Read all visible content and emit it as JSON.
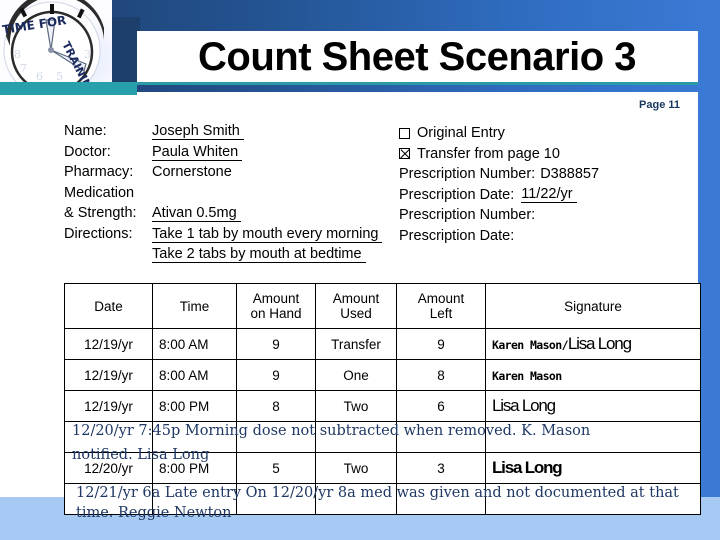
{
  "header": {
    "title": "Count Sheet Scenario 3",
    "page_label": "Page 11",
    "logo_line1": "TIME FOR",
    "logo_line2": "TRAINING",
    "accent_teal": "#2a9aa6",
    "accent_blue": "#3a79d4",
    "navy": "#1e3e6b"
  },
  "form": {
    "left": [
      {
        "label": "Name:",
        "value": "Joseph Smith",
        "underline": true
      },
      {
        "label": "Doctor:",
        "value": "Paula Whiten",
        "underline": true
      },
      {
        "label": "Pharmacy:",
        "value": "Cornerstone",
        "underline": false
      },
      {
        "label": "Medication",
        "value": "",
        "underline": false
      },
      {
        "label": "& Strength:",
        "value": "Ativan 0.5mg",
        "underline": true
      },
      {
        "label": "Directions:",
        "value": "Take 1 tab by mouth every morning",
        "underline": true
      },
      {
        "label": "",
        "value": "Take 2 tabs by mouth at bedtime",
        "underline": true
      }
    ],
    "right": {
      "original_entry_label": "Original Entry",
      "original_entry_checked": false,
      "transfer_label": "Transfer  from page 10",
      "transfer_checked": true,
      "rx_number_label": "Prescription Number:",
      "rx_number_value": "D388857",
      "rx_date_label": "Prescription Date:",
      "rx_date_value": "11/22/yr",
      "rx_number_label_2": "Prescription Number:",
      "rx_number_value_2": "",
      "rx_date_label_2": "Prescription Date:",
      "rx_date_value_2": ""
    }
  },
  "table": {
    "headers": [
      {
        "line1": "Date",
        "line2": ""
      },
      {
        "line1": "Time",
        "line2": ""
      },
      {
        "line1": "Amount",
        "line2": "on Hand"
      },
      {
        "line1": "Amount",
        "line2": "Used"
      },
      {
        "line1": "Amount",
        "line2": "Left"
      },
      {
        "line1": "Signature",
        "line2": ""
      }
    ],
    "rows": [
      {
        "date": "12/19/yr",
        "time": "8:00 AM",
        "on_hand": "9",
        "used": "Transfer",
        "left": "9",
        "sig_a": "Karen Mason",
        "sig_sep": "/",
        "sig_b": "Lisa Long",
        "sig_b_bold": false
      },
      {
        "date": "12/19/yr",
        "time": "8:00 AM",
        "on_hand": "9",
        "used": "One",
        "left": "8",
        "sig_a": "Karen Mason",
        "sig_sep": "",
        "sig_b": "",
        "sig_b_bold": false
      },
      {
        "date": "12/19/yr",
        "time": "8:00 PM",
        "on_hand": "8",
        "used": "Two",
        "left": "6",
        "sig_a": "",
        "sig_sep": "",
        "sig_b": "Lisa Long",
        "sig_b_bold": false
      },
      {
        "date": "",
        "time": "",
        "on_hand": "",
        "used": "",
        "left": "",
        "sig_a": "",
        "sig_sep": "",
        "sig_b": "",
        "sig_b_bold": false
      },
      {
        "date": "12/20/yr",
        "time": "8:00 PM",
        "on_hand": "5",
        "used": "Two",
        "left": "3",
        "sig_a": "",
        "sig_sep": "",
        "sig_b": "Lisa Long",
        "sig_b_bold": true
      },
      {
        "date": "",
        "time": "",
        "on_hand": "",
        "used": "",
        "left": "",
        "sig_a": "",
        "sig_sep": "",
        "sig_b": "",
        "sig_b_bold": false
      }
    ]
  },
  "notes": {
    "note1_line1": "12/20/yr 7:45p Morning dose not subtracted when removed.  K. Mason",
    "note1_line2": "notified. Lisa Long",
    "note2_line1": "12/21/yr 6a  Late entry On 12/20/yr 8a med was given and not documented at that",
    "note2_line2": "time. Reggie Newton",
    "color": "#1f3864"
  }
}
